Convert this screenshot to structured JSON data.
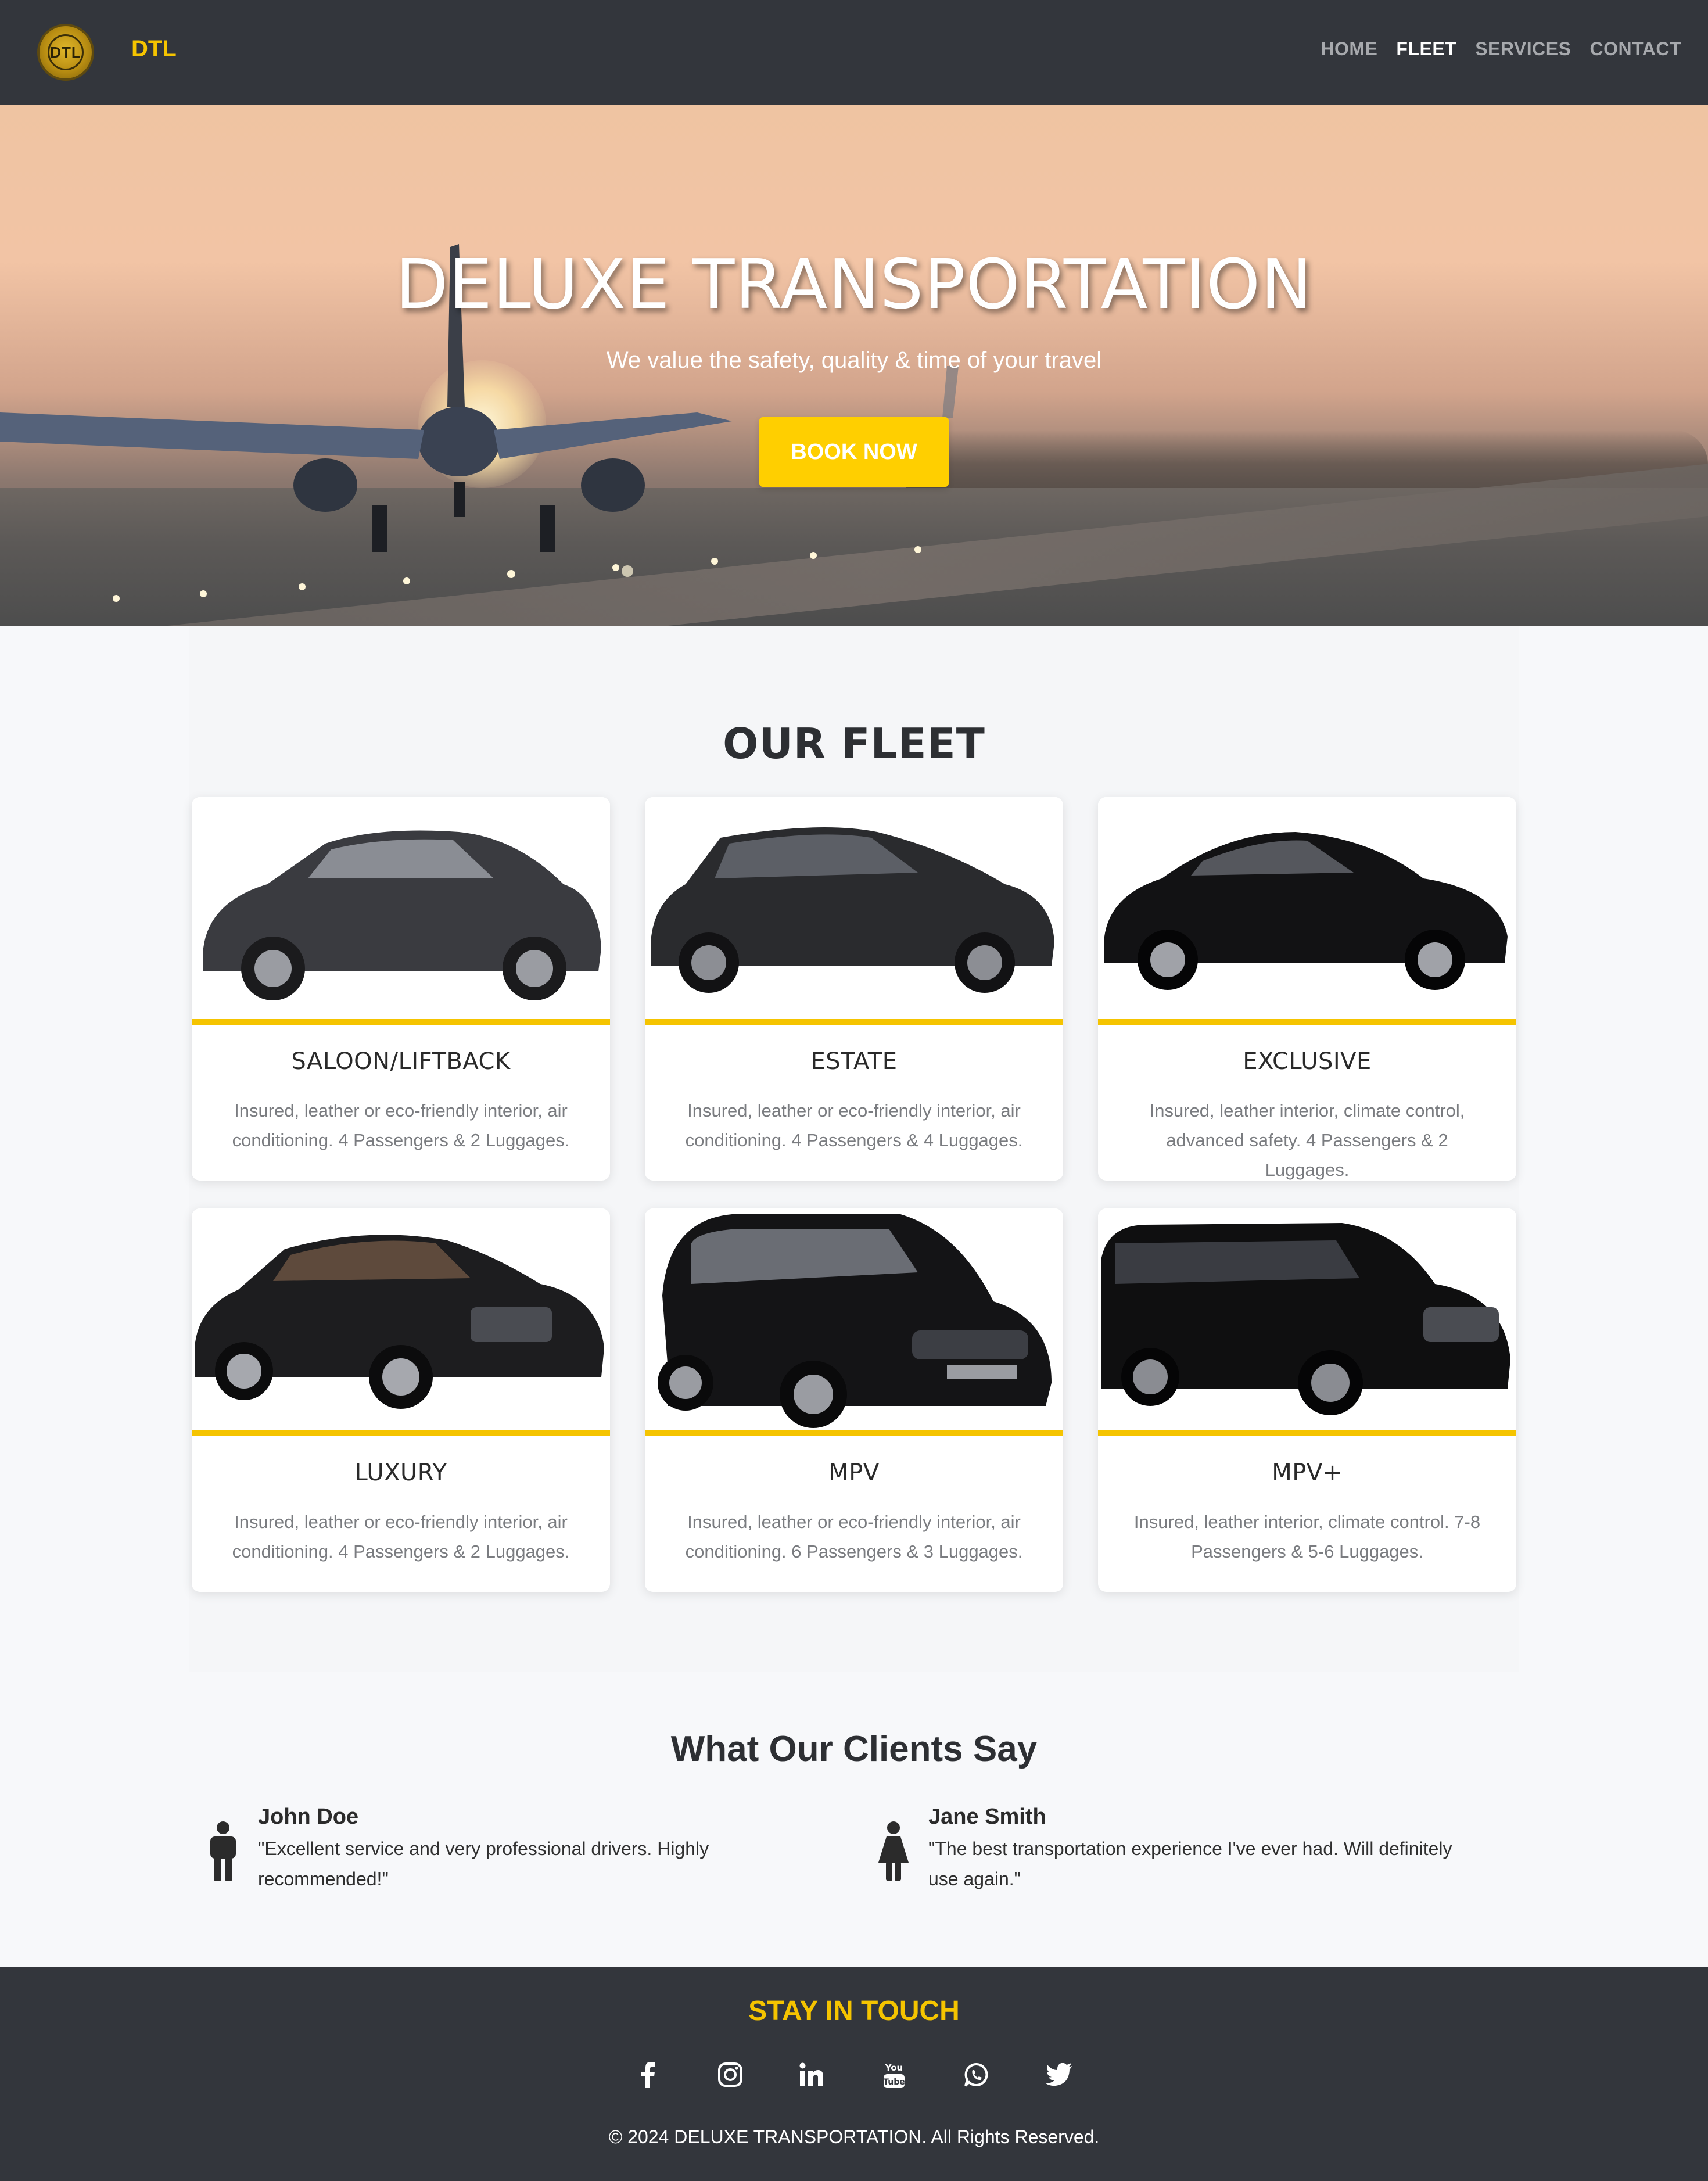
{
  "header": {
    "logo_text": "DTL",
    "brand": "DTL",
    "nav": [
      {
        "label": "HOME",
        "active": false
      },
      {
        "label": "FLEET",
        "active": true
      },
      {
        "label": "SERVICES",
        "active": false
      },
      {
        "label": "CONTACT",
        "active": false
      }
    ]
  },
  "hero": {
    "title": "DELUXE TRANSPORTATION",
    "subtitle": "We value the safety, quality & time of your travel",
    "cta_label": "BOOK NOW"
  },
  "fleet": {
    "title": "OUR FLEET",
    "cards": [
      {
        "title": "SALOON/LIFTBACK",
        "description": "Insured, leather or eco-friendly interior, air conditioning. 4 Passengers & 2 Luggages.",
        "car_color": "#3a3b40"
      },
      {
        "title": "ESTATE",
        "description": "Insured, leather or eco-friendly interior, air conditioning. 4 Passengers & 4 Luggages.",
        "car_color": "#2a2b2e"
      },
      {
        "title": "EXCLUSIVE",
        "description": "Insured, leather interior, climate control, advanced safety. 4 Passengers & 2 Luggages.",
        "car_color": "#121214"
      },
      {
        "title": "LUXURY",
        "description": "Insured, leather or eco-friendly interior, air conditioning. 4 Passengers & 2 Luggages.",
        "car_color": "#1d1d1f"
      },
      {
        "title": "MPV",
        "description": "Insured, leather or eco-friendly interior, air conditioning. 6 Passengers & 3 Luggages.",
        "car_color": "#141416"
      },
      {
        "title": "MPV+",
        "description": "Insured, leather interior, climate control. 7-8 Passengers & 5-6 Luggages.",
        "car_color": "#0f0f10"
      }
    ]
  },
  "testimonials": {
    "title": "What Our Clients Say",
    "items": [
      {
        "name": "John Doe",
        "text": "\"Excellent service and very professional drivers. Highly recommended!\"",
        "icon": "male-person-icon"
      },
      {
        "name": "Jane Smith",
        "text": "\"The best transportation experience I've ever had. Will definitely use again.\"",
        "icon": "female-person-icon"
      }
    ]
  },
  "footer": {
    "title": "STAY IN TOUCH",
    "socials": [
      "facebook-icon",
      "instagram-icon",
      "linkedin-icon",
      "youtube-icon",
      "whatsapp-icon",
      "twitter-icon"
    ],
    "copyright": "© 2024 DELUXE TRANSPORTATION. All Rights Reserved."
  },
  "colors": {
    "accent": "#f5c400",
    "header_bg": "#33363c",
    "cta_bg": "#ffcf00"
  }
}
